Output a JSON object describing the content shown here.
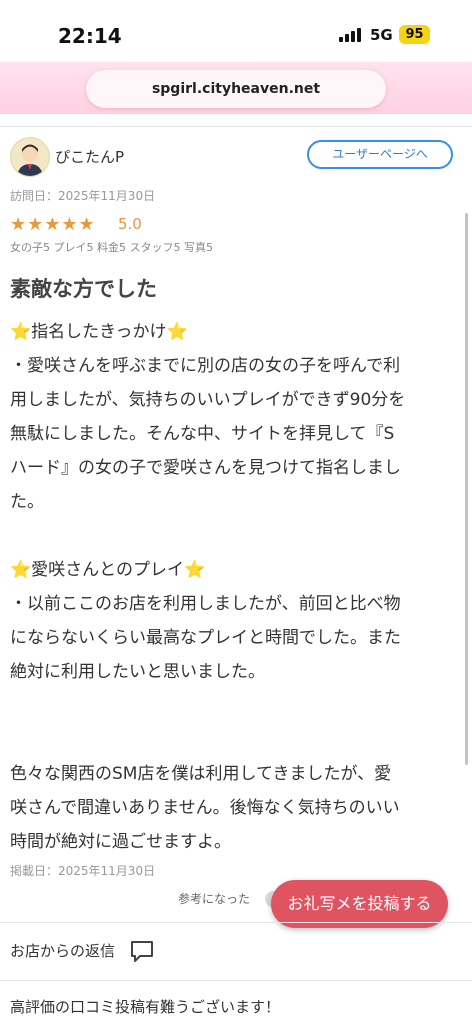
{
  "status_bar": {
    "time": "22:14",
    "network": "5G",
    "battery": "95"
  },
  "browser": {
    "url": "spgirl.cityheaven.net"
  },
  "review": {
    "username": "ぴこたんP",
    "user_page_button": "ユーザーページへ",
    "visit_date": "訪問日：2025年11月30日",
    "stars": "★★★★★",
    "rating": "5.0",
    "sub_ratings": "女の子5 プレイ5 料金5 スタッフ5 写真5",
    "title": "素敵な方でした",
    "lines": [
      "⭐指名したきっかけ⭐",
      "・愛咲さんを呼ぶまでに別の店の女の子を呼んで利",
      "用しましたが、気持ちのいいプレイができず90分を",
      "無駄にしました。そんな中、サイトを拝見して『S",
      "ハード』の女の子で愛咲さんを見つけて指名しまし",
      "た。",
      "⭐愛咲さんとのプレイ⭐",
      "・以前ここのお店を利用しましたが、前回と比べ物",
      "にならないくらい最高なプレイと時間でした。また",
      "絶対に利用したいと思いました。",
      "色々な関西のSM店を僕は利用してきましたが、愛",
      "咲さんで間違いありません。後悔なく気持ちのいい",
      "時間が絶対に過ごせますよ。"
    ],
    "posted_date": "掲載日：2025年11月30日",
    "helpful_label": "参考になった"
  },
  "fab_label": "お礼写メを投稿する",
  "shop_reply": {
    "label": "お店からの返信",
    "text": "高評価の口コミ投稿有難うございます！"
  },
  "colors": {
    "star": "#e8993a",
    "fab": "#e05462",
    "link_blue": "#2f7fd4",
    "url_bar_pink": "#ffd0e1"
  }
}
